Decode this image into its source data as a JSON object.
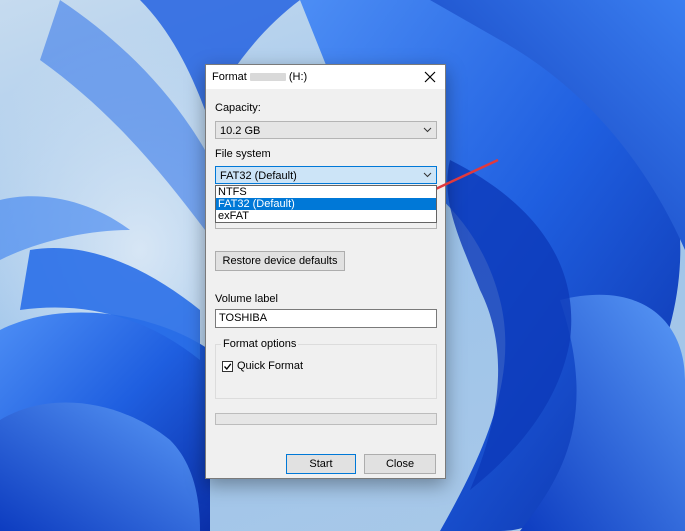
{
  "dialog": {
    "title_prefix": "Format",
    "title_suffix": "(H:)",
    "capacity_label": "Capacity:",
    "capacity_value": "10.2 GB",
    "file_system_label": "File system",
    "file_system_value": "FAT32 (Default)",
    "file_system_options": [
      "NTFS",
      "FAT32 (Default)",
      "exFAT"
    ],
    "selected_option_index": 1,
    "restore_button": "Restore device defaults",
    "volume_label_label": "Volume label",
    "volume_label_value": "TOSHIBA",
    "format_options_title": "Format options",
    "quick_format_label": "Quick Format",
    "quick_format_checked": true,
    "progress_fraction": 0,
    "start_button": "Start",
    "close_button": "Close"
  },
  "colors": {
    "dialog_bg": "#f0f0f0",
    "selection": "#0078d7",
    "annotation_arrow": "#e0393e",
    "wallpaper_blue": "#1a5fe0"
  },
  "icons": [
    "close-icon",
    "chevron-down-icon",
    "checkmark-icon",
    "annotation-arrow"
  ]
}
